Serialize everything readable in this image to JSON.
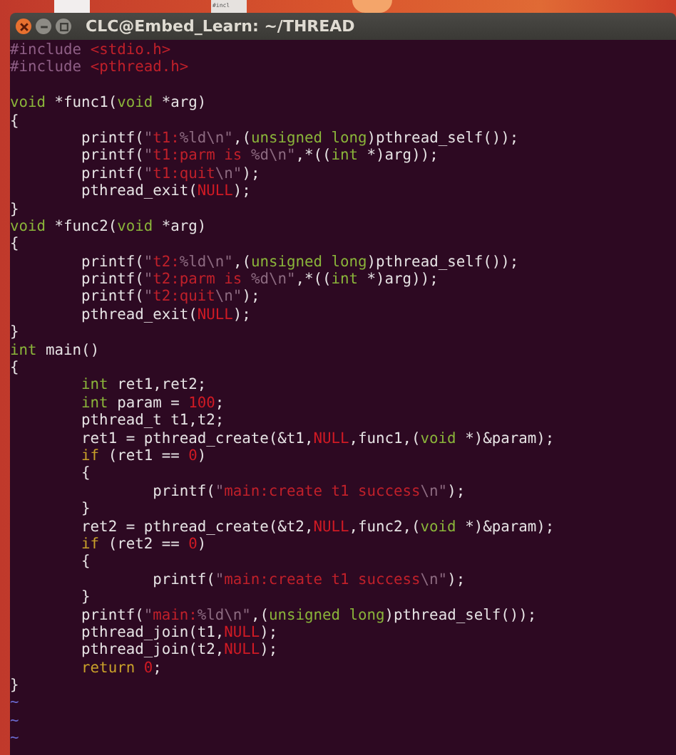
{
  "desktop": {
    "thumbnail_text": "#incl"
  },
  "window": {
    "title": "CLC@Embed_Learn: ~/THREAD"
  },
  "lines": [
    {
      "kind": "code",
      "segments": [
        {
          "text": "#include ",
          "kind": "preproc"
        },
        {
          "text": "<stdio.h>",
          "kind": "string"
        }
      ]
    },
    {
      "kind": "code",
      "segments": [
        {
          "text": "#include ",
          "kind": "preproc"
        },
        {
          "text": "<pthread.h>",
          "kind": "string"
        }
      ]
    },
    {
      "kind": "blank"
    },
    {
      "kind": "code",
      "segments": [
        {
          "text": "void",
          "kind": "type"
        },
        {
          "text": " *func1(",
          "kind": "plain"
        },
        {
          "text": "void",
          "kind": "type"
        },
        {
          "text": " *arg)",
          "kind": "plain"
        }
      ]
    },
    {
      "kind": "code",
      "segments": [
        {
          "text": "{",
          "kind": "plain"
        }
      ]
    },
    {
      "kind": "code",
      "segments": [
        {
          "text": "        printf(",
          "kind": "plain"
        },
        {
          "text": "\"",
          "kind": "special"
        },
        {
          "text": "t1:",
          "kind": "string"
        },
        {
          "text": "%ld\\n\"",
          "kind": "special"
        },
        {
          "text": ",(",
          "kind": "plain"
        },
        {
          "text": "unsigned long",
          "kind": "type"
        },
        {
          "text": ")pthread_self());",
          "kind": "plain"
        }
      ]
    },
    {
      "kind": "code",
      "segments": [
        {
          "text": "        printf(",
          "kind": "plain"
        },
        {
          "text": "\"",
          "kind": "special"
        },
        {
          "text": "t1:parm is ",
          "kind": "string"
        },
        {
          "text": "%d\\n\"",
          "kind": "special"
        },
        {
          "text": ",*((",
          "kind": "plain"
        },
        {
          "text": "int",
          "kind": "type"
        },
        {
          "text": " *)arg));",
          "kind": "plain"
        }
      ]
    },
    {
      "kind": "code",
      "segments": [
        {
          "text": "        printf(",
          "kind": "plain"
        },
        {
          "text": "\"",
          "kind": "special"
        },
        {
          "text": "t1:quit",
          "kind": "string"
        },
        {
          "text": "\\n\"",
          "kind": "special"
        },
        {
          "text": ");",
          "kind": "plain"
        }
      ]
    },
    {
      "kind": "code",
      "segments": [
        {
          "text": "        pthread_exit(",
          "kind": "plain"
        },
        {
          "text": "NULL",
          "kind": "constant"
        },
        {
          "text": ");",
          "kind": "plain"
        }
      ]
    },
    {
      "kind": "code",
      "segments": [
        {
          "text": "}",
          "kind": "plain"
        }
      ]
    },
    {
      "kind": "code",
      "segments": [
        {
          "text": "void",
          "kind": "type"
        },
        {
          "text": " *func2(",
          "kind": "plain"
        },
        {
          "text": "void",
          "kind": "type"
        },
        {
          "text": " *arg)",
          "kind": "plain"
        }
      ]
    },
    {
      "kind": "code",
      "segments": [
        {
          "text": "{",
          "kind": "plain"
        }
      ]
    },
    {
      "kind": "code",
      "segments": [
        {
          "text": "        printf(",
          "kind": "plain"
        },
        {
          "text": "\"",
          "kind": "special"
        },
        {
          "text": "t2:",
          "kind": "string"
        },
        {
          "text": "%ld\\n\"",
          "kind": "special"
        },
        {
          "text": ",(",
          "kind": "plain"
        },
        {
          "text": "unsigned long",
          "kind": "type"
        },
        {
          "text": ")pthread_self());",
          "kind": "plain"
        }
      ]
    },
    {
      "kind": "code",
      "segments": [
        {
          "text": "        printf(",
          "kind": "plain"
        },
        {
          "text": "\"",
          "kind": "special"
        },
        {
          "text": "t2:parm is ",
          "kind": "string"
        },
        {
          "text": "%d\\n\"",
          "kind": "special"
        },
        {
          "text": ",*((",
          "kind": "plain"
        },
        {
          "text": "int",
          "kind": "type"
        },
        {
          "text": " *)arg));",
          "kind": "plain"
        }
      ]
    },
    {
      "kind": "code",
      "segments": [
        {
          "text": "        printf(",
          "kind": "plain"
        },
        {
          "text": "\"",
          "kind": "special"
        },
        {
          "text": "t2:quit",
          "kind": "string"
        },
        {
          "text": "\\n\"",
          "kind": "special"
        },
        {
          "text": ");",
          "kind": "plain"
        }
      ]
    },
    {
      "kind": "code",
      "segments": [
        {
          "text": "        pthread_exit(",
          "kind": "plain"
        },
        {
          "text": "NULL",
          "kind": "constant"
        },
        {
          "text": ");",
          "kind": "plain"
        }
      ]
    },
    {
      "kind": "code",
      "segments": [
        {
          "text": "}",
          "kind": "plain"
        }
      ]
    },
    {
      "kind": "code",
      "segments": [
        {
          "text": "int",
          "kind": "type"
        },
        {
          "text": " main()",
          "kind": "plain"
        }
      ]
    },
    {
      "kind": "code",
      "segments": [
        {
          "text": "{",
          "kind": "plain"
        }
      ]
    },
    {
      "kind": "code",
      "segments": [
        {
          "text": "        int",
          "kind": "type"
        },
        {
          "text": " ret1,ret2;",
          "kind": "plain"
        }
      ]
    },
    {
      "kind": "code",
      "segments": [
        {
          "text": "        int",
          "kind": "type"
        },
        {
          "text": " param = ",
          "kind": "plain"
        },
        {
          "text": "100",
          "kind": "constant"
        },
        {
          "text": ";",
          "kind": "plain"
        }
      ]
    },
    {
      "kind": "code",
      "segments": [
        {
          "text": "        pthread_t t1,t2;",
          "kind": "plain"
        }
      ]
    },
    {
      "kind": "code",
      "segments": [
        {
          "text": "        ret1 = pthread_create(&t1,",
          "kind": "plain"
        },
        {
          "text": "NULL",
          "kind": "constant"
        },
        {
          "text": ",func1,(",
          "kind": "plain"
        },
        {
          "text": "void",
          "kind": "type"
        },
        {
          "text": " *)&param);",
          "kind": "plain"
        }
      ]
    },
    {
      "kind": "code",
      "segments": [
        {
          "text": "        if",
          "kind": "keyword"
        },
        {
          "text": " (ret1 == ",
          "kind": "plain"
        },
        {
          "text": "0",
          "kind": "constant"
        },
        {
          "text": ")",
          "kind": "plain"
        }
      ]
    },
    {
      "kind": "code",
      "segments": [
        {
          "text": "        {",
          "kind": "plain"
        }
      ]
    },
    {
      "kind": "code",
      "segments": [
        {
          "text": "                printf(",
          "kind": "plain"
        },
        {
          "text": "\"",
          "kind": "special"
        },
        {
          "text": "main:create t1 success",
          "kind": "string"
        },
        {
          "text": "\\n\"",
          "kind": "special"
        },
        {
          "text": ");",
          "kind": "plain"
        }
      ]
    },
    {
      "kind": "code",
      "segments": [
        {
          "text": "        }",
          "kind": "plain"
        }
      ]
    },
    {
      "kind": "code",
      "segments": [
        {
          "text": "        ret2 = pthread_create(&t2,",
          "kind": "plain"
        },
        {
          "text": "NULL",
          "kind": "constant"
        },
        {
          "text": ",func2,(",
          "kind": "plain"
        },
        {
          "text": "void",
          "kind": "type"
        },
        {
          "text": " *)&param);",
          "kind": "plain"
        }
      ]
    },
    {
      "kind": "code",
      "segments": [
        {
          "text": "        if",
          "kind": "keyword"
        },
        {
          "text": " (ret2 == ",
          "kind": "plain"
        },
        {
          "text": "0",
          "kind": "constant"
        },
        {
          "text": ")",
          "kind": "plain"
        }
      ]
    },
    {
      "kind": "code",
      "segments": [
        {
          "text": "        {",
          "kind": "plain"
        }
      ]
    },
    {
      "kind": "code",
      "segments": [
        {
          "text": "                printf(",
          "kind": "plain"
        },
        {
          "text": "\"",
          "kind": "special"
        },
        {
          "text": "main:create t1 success",
          "kind": "string"
        },
        {
          "text": "\\n\"",
          "kind": "special"
        },
        {
          "text": ");",
          "kind": "plain"
        }
      ]
    },
    {
      "kind": "code",
      "segments": [
        {
          "text": "        }",
          "kind": "plain"
        }
      ]
    },
    {
      "kind": "code",
      "segments": [
        {
          "text": "        printf(",
          "kind": "plain"
        },
        {
          "text": "\"",
          "kind": "special"
        },
        {
          "text": "main:",
          "kind": "string"
        },
        {
          "text": "%ld\\n\"",
          "kind": "special"
        },
        {
          "text": ",(",
          "kind": "plain"
        },
        {
          "text": "unsigned long",
          "kind": "type"
        },
        {
          "text": ")pthread_self());",
          "kind": "plain"
        }
      ]
    },
    {
      "kind": "code",
      "segments": [
        {
          "text": "        pthread_join(t1,",
          "kind": "plain"
        },
        {
          "text": "NULL",
          "kind": "constant"
        },
        {
          "text": ");",
          "kind": "plain"
        }
      ]
    },
    {
      "kind": "code",
      "segments": [
        {
          "text": "        pthread_join(t2,",
          "kind": "plain"
        },
        {
          "text": "NULL",
          "kind": "constant"
        },
        {
          "text": ");",
          "kind": "plain"
        }
      ]
    },
    {
      "kind": "code",
      "segments": [
        {
          "text": "        return ",
          "kind": "keyword"
        },
        {
          "text": "0",
          "kind": "constant"
        },
        {
          "text": ";",
          "kind": "plain"
        }
      ]
    },
    {
      "kind": "code",
      "segments": [
        {
          "text": "}",
          "kind": "plain"
        }
      ]
    },
    {
      "kind": "tilde",
      "text": "~"
    },
    {
      "kind": "tilde",
      "text": "~"
    },
    {
      "kind": "tilde",
      "text": "~"
    }
  ]
}
